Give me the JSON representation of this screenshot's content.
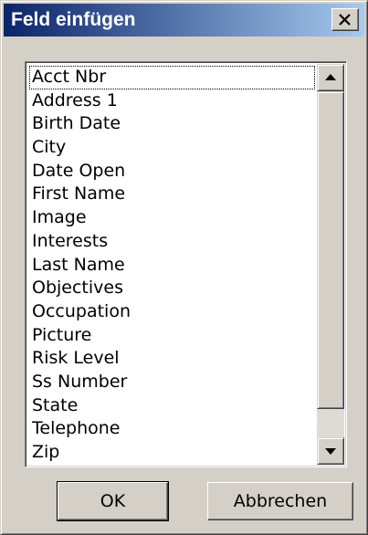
{
  "dialog": {
    "title": "Feld einfügen"
  },
  "fields": {
    "items": [
      "Acct Nbr",
      "Address 1",
      "Birth Date",
      "City",
      "Date Open",
      "First Name",
      "Image",
      "Interests",
      "Last Name",
      "Objectives",
      "Occupation",
      "Picture",
      "Risk Level",
      "Ss Number",
      "State",
      "Telephone",
      "Zip"
    ],
    "focused_index": 0
  },
  "buttons": {
    "ok_label": "OK",
    "cancel_label": "Abbrechen"
  },
  "icons": {
    "close": "close-icon",
    "scroll_up": "arrow-up-icon",
    "scroll_down": "arrow-down-icon"
  }
}
